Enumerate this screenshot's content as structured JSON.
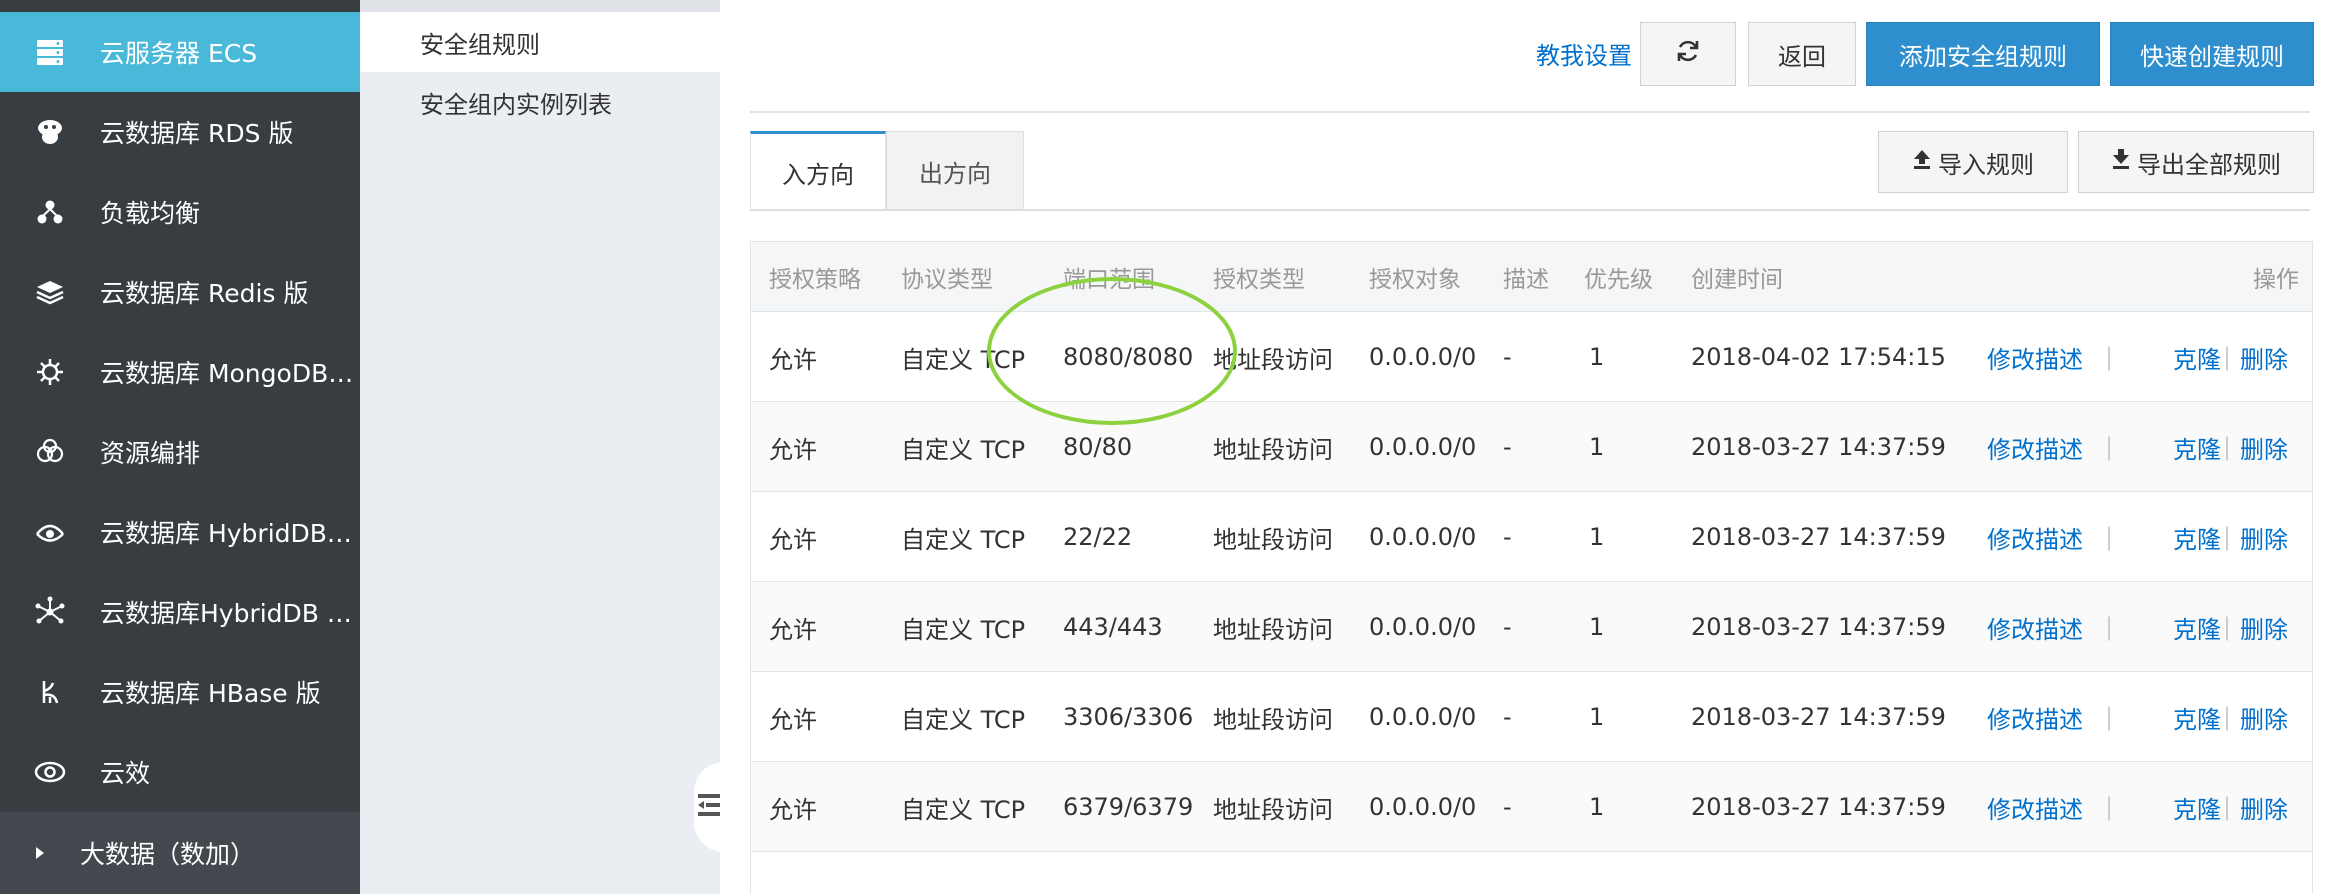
{
  "sidebar": {
    "items": [
      {
        "label": "云服务器 ECS",
        "icon": "server-icon"
      },
      {
        "label": "云数据库 RDS 版",
        "icon": "database-icon"
      },
      {
        "label": "负载均衡",
        "icon": "load-balancer-icon"
      },
      {
        "label": "云数据库 Redis 版",
        "icon": "layers-icon"
      },
      {
        "label": "云数据库 MongoDB 版",
        "icon": "gear-icon"
      },
      {
        "label": "资源编排",
        "icon": "cloud-nodes-icon"
      },
      {
        "label": "云数据库 HybridDB f…",
        "icon": "eye-ring-icon"
      },
      {
        "label": "云数据库HybridDB fo…",
        "icon": "network-icon"
      },
      {
        "label": "云数据库 HBase 版",
        "icon": "branch-icon"
      },
      {
        "label": "云效",
        "icon": "eye-icon"
      }
    ],
    "group": {
      "label": "大数据（数加）",
      "icon": "caret-right-icon"
    }
  },
  "subnav": {
    "items": [
      "安全组规则",
      "安全组内实例列表"
    ]
  },
  "toolbar": {
    "help": "教我设置",
    "refresh_icon": "refresh-icon",
    "back": "返回",
    "add_rule": "添加安全组规则",
    "quick_create": "快速创建规则",
    "import": "导入规则",
    "export": "导出全部规则"
  },
  "tabs": [
    "入方向",
    "出方向"
  ],
  "table": {
    "headers": [
      "授权策略",
      "协议类型",
      "端口范围",
      "授权类型",
      "授权对象",
      "描述",
      "优先级",
      "创建时间",
      "操作"
    ],
    "rows": [
      [
        "允许",
        "自定义 TCP",
        "8080/8080",
        "地址段访问",
        "0.0.0.0/0",
        "-",
        "1",
        "2018-04-02 17:54:15"
      ],
      [
        "允许",
        "自定义 TCP",
        "80/80",
        "地址段访问",
        "0.0.0.0/0",
        "-",
        "1",
        "2018-03-27 14:37:59"
      ],
      [
        "允许",
        "自定义 TCP",
        "22/22",
        "地址段访问",
        "0.0.0.0/0",
        "-",
        "1",
        "2018-03-27 14:37:59"
      ],
      [
        "允许",
        "自定义 TCP",
        "443/443",
        "地址段访问",
        "0.0.0.0/0",
        "-",
        "1",
        "2018-03-27 14:37:59"
      ],
      [
        "允许",
        "自定义 TCP",
        "3306/3306",
        "地址段访问",
        "0.0.0.0/0",
        "-",
        "1",
        "2018-03-27 14:37:59"
      ],
      [
        "允许",
        "自定义 TCP",
        "6379/6379",
        "地址段访问",
        "0.0.0.0/0",
        "-",
        "1",
        "2018-03-27 14:37:59"
      ]
    ],
    "actions": {
      "edit": "修改描述",
      "clone": "克隆",
      "delete": "删除",
      "separator": "|"
    }
  },
  "colors": {
    "sidebar_bg": "#373d41",
    "sidebar_active": "#4ab8d9",
    "primary": "#2f8fce",
    "link": "#0070cc",
    "highlight": "#8cd23f"
  }
}
